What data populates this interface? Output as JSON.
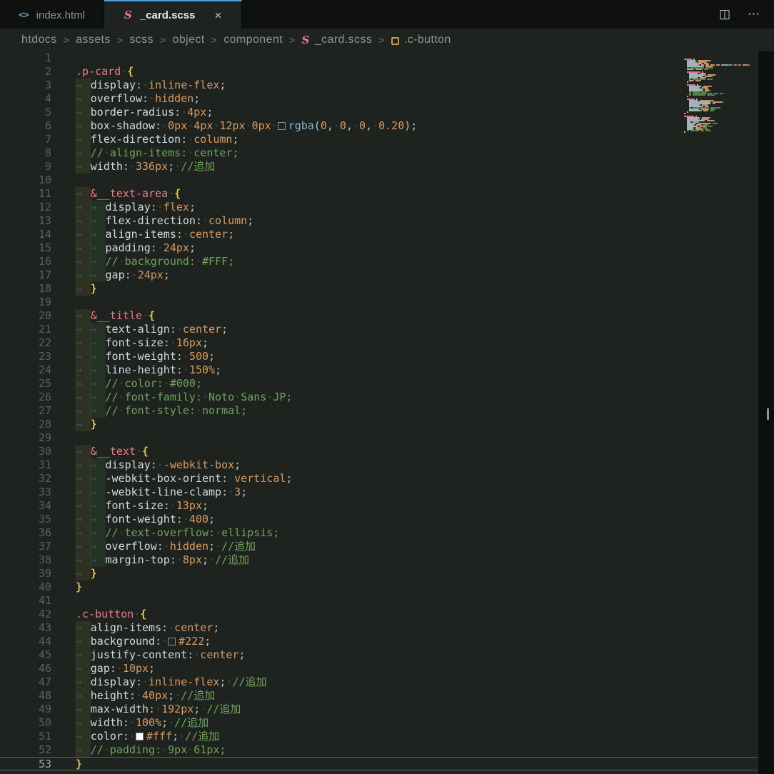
{
  "tabs": [
    {
      "label": "index.html"
    },
    {
      "label": "_card.scss"
    }
  ],
  "icons": {
    "html_file": "<>",
    "sass": "S",
    "close": "×",
    "split_editor": "◫",
    "more_actions": "⋯"
  },
  "breadcrumb": {
    "separator": ">",
    "items": [
      "htdocs",
      "assets",
      "scss",
      "object",
      "component",
      "_card.scss",
      ".c-button"
    ]
  },
  "colors": {
    "background": "#1e231f",
    "tabbar_background": "#0e110e",
    "accent_blue": "#4f9fd8",
    "selector_pink": "#f0788c",
    "brace_yellow": "#e2c05a",
    "property_fg": "#d2dade",
    "value_orange": "#d89a62",
    "comment_green": "#6fa35a",
    "function_blue": "#7ab8d8",
    "sass_icon_pink": "#e977a0",
    "class_symbol_orange": "#d89a40"
  },
  "editor": {
    "current_line": 53,
    "lines": [
      [],
      [
        [
          "sel",
          ".p-card"
        ],
        [
          "ws",
          "·"
        ],
        [
          "brace",
          "{"
        ]
      ],
      [
        [
          "t1",
          "→"
        ],
        [
          "prop",
          "display"
        ],
        [
          "op",
          ":"
        ],
        [
          "ws",
          "·"
        ],
        [
          "val",
          "inline-flex"
        ],
        [
          "op",
          ";"
        ]
      ],
      [
        [
          "t1",
          "→"
        ],
        [
          "prop",
          "overflow"
        ],
        [
          "op",
          ":"
        ],
        [
          "ws",
          "·"
        ],
        [
          "val",
          "hidden"
        ],
        [
          "op",
          ";"
        ]
      ],
      [
        [
          "t1",
          "→"
        ],
        [
          "prop",
          "border-radius"
        ],
        [
          "op",
          ":"
        ],
        [
          "ws",
          "·"
        ],
        [
          "num",
          "4px"
        ],
        [
          "op",
          ";"
        ]
      ],
      [
        [
          "t1",
          "→"
        ],
        [
          "prop",
          "box-shadow"
        ],
        [
          "op",
          ":"
        ],
        [
          "ws",
          "·"
        ],
        [
          "num",
          "0px"
        ],
        [
          "ws",
          "·"
        ],
        [
          "num",
          "4px"
        ],
        [
          "ws",
          "·"
        ],
        [
          "num",
          "12px"
        ],
        [
          "ws",
          "·"
        ],
        [
          "num",
          "0px"
        ],
        [
          "ws",
          "·"
        ],
        [
          "sw",
          "transparent"
        ],
        [
          "fn",
          "rgba"
        ],
        [
          "op",
          "("
        ],
        [
          "num",
          "0"
        ],
        [
          "op",
          ","
        ],
        [
          "ws",
          "·"
        ],
        [
          "num",
          "0"
        ],
        [
          "op",
          ","
        ],
        [
          "ws",
          "·"
        ],
        [
          "num",
          "0"
        ],
        [
          "op",
          ","
        ],
        [
          "ws",
          "·"
        ],
        [
          "num",
          "0.20"
        ],
        [
          "op",
          ")"
        ],
        [
          "op",
          ";"
        ]
      ],
      [
        [
          "t1",
          "→"
        ],
        [
          "prop",
          "flex-direction"
        ],
        [
          "op",
          ":"
        ],
        [
          "ws",
          "·"
        ],
        [
          "val",
          "column"
        ],
        [
          "op",
          ";"
        ]
      ],
      [
        [
          "t1",
          "→"
        ],
        [
          "cm",
          "//"
        ],
        [
          "ws",
          "·"
        ],
        [
          "cm",
          "align-items:"
        ],
        [
          "ws",
          "·"
        ],
        [
          "cm",
          "center;"
        ]
      ],
      [
        [
          "t1",
          "→"
        ],
        [
          "prop",
          "width"
        ],
        [
          "op",
          ":"
        ],
        [
          "ws",
          "·"
        ],
        [
          "num",
          "336px"
        ],
        [
          "op",
          ";"
        ],
        [
          "ws",
          "·"
        ],
        [
          "cm",
          "//追加"
        ]
      ],
      [],
      [
        [
          "t1",
          "→"
        ],
        [
          "sel",
          "&__text-area"
        ],
        [
          "ws",
          "·"
        ],
        [
          "brace",
          "{"
        ]
      ],
      [
        [
          "t1",
          "→"
        ],
        [
          "t2",
          "→"
        ],
        [
          "prop",
          "display"
        ],
        [
          "op",
          ":"
        ],
        [
          "ws",
          "·"
        ],
        [
          "val",
          "flex"
        ],
        [
          "op",
          ";"
        ]
      ],
      [
        [
          "t1",
          "→"
        ],
        [
          "t2",
          "→"
        ],
        [
          "prop",
          "flex-direction"
        ],
        [
          "op",
          ":"
        ],
        [
          "ws",
          "·"
        ],
        [
          "val",
          "column"
        ],
        [
          "op",
          ";"
        ]
      ],
      [
        [
          "t1",
          "→"
        ],
        [
          "t2",
          "→"
        ],
        [
          "prop",
          "align-items"
        ],
        [
          "op",
          ":"
        ],
        [
          "ws",
          "·"
        ],
        [
          "val",
          "center"
        ],
        [
          "op",
          ";"
        ]
      ],
      [
        [
          "t1",
          "→"
        ],
        [
          "t2",
          "→"
        ],
        [
          "prop",
          "padding"
        ],
        [
          "op",
          ":"
        ],
        [
          "ws",
          "·"
        ],
        [
          "num",
          "24px"
        ],
        [
          "op",
          ";"
        ]
      ],
      [
        [
          "t1",
          "→"
        ],
        [
          "t2",
          "→"
        ],
        [
          "cm",
          "//"
        ],
        [
          "ws",
          "·"
        ],
        [
          "cm",
          "background:"
        ],
        [
          "ws",
          "·"
        ],
        [
          "cm",
          "#FFF;"
        ]
      ],
      [
        [
          "t1",
          "→"
        ],
        [
          "t2",
          "→"
        ],
        [
          "prop",
          "gap"
        ],
        [
          "op",
          ":"
        ],
        [
          "ws",
          "·"
        ],
        [
          "num",
          "24px"
        ],
        [
          "op",
          ";"
        ]
      ],
      [
        [
          "t1",
          "→"
        ],
        [
          "brace",
          "}"
        ]
      ],
      [],
      [
        [
          "t1",
          "→"
        ],
        [
          "sel",
          "&__title"
        ],
        [
          "ws",
          "·"
        ],
        [
          "brace",
          "{"
        ]
      ],
      [
        [
          "t1",
          "→"
        ],
        [
          "t2",
          "→"
        ],
        [
          "prop",
          "text-align"
        ],
        [
          "op",
          ":"
        ],
        [
          "ws",
          "·"
        ],
        [
          "val",
          "center"
        ],
        [
          "op",
          ";"
        ]
      ],
      [
        [
          "t1",
          "→"
        ],
        [
          "t2",
          "→"
        ],
        [
          "prop",
          "font-size"
        ],
        [
          "op",
          ":"
        ],
        [
          "ws",
          "·"
        ],
        [
          "num",
          "16px"
        ],
        [
          "op",
          ";"
        ]
      ],
      [
        [
          "t1",
          "→"
        ],
        [
          "t2",
          "→"
        ],
        [
          "prop",
          "font-weight"
        ],
        [
          "op",
          ":"
        ],
        [
          "ws",
          "·"
        ],
        [
          "num",
          "500"
        ],
        [
          "op",
          ";"
        ]
      ],
      [
        [
          "t1",
          "→"
        ],
        [
          "t2",
          "→"
        ],
        [
          "prop",
          "line-height"
        ],
        [
          "op",
          ":"
        ],
        [
          "ws",
          "·"
        ],
        [
          "num",
          "150%"
        ],
        [
          "op",
          ";"
        ]
      ],
      [
        [
          "t1",
          "→"
        ],
        [
          "t2",
          "→"
        ],
        [
          "cm",
          "//"
        ],
        [
          "ws",
          "·"
        ],
        [
          "cm",
          "color:"
        ],
        [
          "ws",
          "·"
        ],
        [
          "cm",
          "#000;"
        ]
      ],
      [
        [
          "t1",
          "→"
        ],
        [
          "t2",
          "→"
        ],
        [
          "cm",
          "//"
        ],
        [
          "ws",
          "·"
        ],
        [
          "cm",
          "font-family:"
        ],
        [
          "ws",
          "·"
        ],
        [
          "cm",
          "Noto"
        ],
        [
          "ws",
          "·"
        ],
        [
          "cm",
          "Sans"
        ],
        [
          "ws",
          "·"
        ],
        [
          "cm",
          "JP;"
        ]
      ],
      [
        [
          "t1",
          "→"
        ],
        [
          "t2",
          "→"
        ],
        [
          "cm",
          "//"
        ],
        [
          "ws",
          "·"
        ],
        [
          "cm",
          "font-style:"
        ],
        [
          "ws",
          "·"
        ],
        [
          "cm",
          "normal;"
        ]
      ],
      [
        [
          "t1",
          "→"
        ],
        [
          "brace",
          "}"
        ]
      ],
      [],
      [
        [
          "t1",
          "→"
        ],
        [
          "sel",
          "&__text"
        ],
        [
          "ws",
          "·"
        ],
        [
          "brace",
          "{"
        ]
      ],
      [
        [
          "t1",
          "→"
        ],
        [
          "t2",
          "→"
        ],
        [
          "prop",
          "display"
        ],
        [
          "op",
          ":"
        ],
        [
          "ws",
          "·"
        ],
        [
          "val",
          "-webkit-box"
        ],
        [
          "op",
          ";"
        ]
      ],
      [
        [
          "t1",
          "→"
        ],
        [
          "t2",
          "→"
        ],
        [
          "prop",
          "-webkit-box-orient"
        ],
        [
          "op",
          ":"
        ],
        [
          "ws",
          "·"
        ],
        [
          "val",
          "vertical"
        ],
        [
          "op",
          ";"
        ]
      ],
      [
        [
          "t1",
          "→"
        ],
        [
          "t2",
          "→"
        ],
        [
          "prop",
          "-webkit-line-clamp"
        ],
        [
          "op",
          ":"
        ],
        [
          "ws",
          "·"
        ],
        [
          "num",
          "3"
        ],
        [
          "op",
          ";"
        ]
      ],
      [
        [
          "t1",
          "→"
        ],
        [
          "t2",
          "→"
        ],
        [
          "prop",
          "font-size"
        ],
        [
          "op",
          ":"
        ],
        [
          "ws",
          "·"
        ],
        [
          "num",
          "13px"
        ],
        [
          "op",
          ";"
        ]
      ],
      [
        [
          "t1",
          "→"
        ],
        [
          "t2",
          "→"
        ],
        [
          "prop",
          "font-weight"
        ],
        [
          "op",
          ":"
        ],
        [
          "ws",
          "·"
        ],
        [
          "num",
          "400"
        ],
        [
          "op",
          ";"
        ]
      ],
      [
        [
          "t1",
          "→"
        ],
        [
          "t2",
          "→"
        ],
        [
          "cm",
          "//"
        ],
        [
          "ws",
          "·"
        ],
        [
          "cm",
          "text-overflow:"
        ],
        [
          "ws",
          "·"
        ],
        [
          "cm",
          "ellipsis;"
        ]
      ],
      [
        [
          "t1",
          "→"
        ],
        [
          "t2",
          "→"
        ],
        [
          "prop",
          "overflow"
        ],
        [
          "op",
          ":"
        ],
        [
          "ws",
          "·"
        ],
        [
          "val",
          "hidden"
        ],
        [
          "op",
          ";"
        ],
        [
          "ws",
          "·"
        ],
        [
          "cm",
          "//追加"
        ]
      ],
      [
        [
          "t1",
          "→"
        ],
        [
          "t2",
          "→"
        ],
        [
          "prop",
          "margin-top"
        ],
        [
          "op",
          ":"
        ],
        [
          "ws",
          "·"
        ],
        [
          "num",
          "8px"
        ],
        [
          "op",
          ";"
        ],
        [
          "ws",
          "·"
        ],
        [
          "cm",
          "//追加"
        ]
      ],
      [
        [
          "t1",
          "→"
        ],
        [
          "brace",
          "}"
        ]
      ],
      [
        [
          "brace",
          "}"
        ]
      ],
      [],
      [
        [
          "sel",
          ".c-button"
        ],
        [
          "ws",
          "·"
        ],
        [
          "brace",
          "{"
        ]
      ],
      [
        [
          "t1",
          "→"
        ],
        [
          "prop",
          "align-items"
        ],
        [
          "op",
          ":"
        ],
        [
          "ws",
          "·"
        ],
        [
          "val",
          "center"
        ],
        [
          "op",
          ";"
        ]
      ],
      [
        [
          "t1",
          "→"
        ],
        [
          "prop",
          "background"
        ],
        [
          "op",
          ":"
        ],
        [
          "ws",
          "·"
        ],
        [
          "sw",
          "#222222"
        ],
        [
          "num",
          "#222"
        ],
        [
          "op",
          ";"
        ]
      ],
      [
        [
          "t1",
          "→"
        ],
        [
          "prop",
          "justify-content"
        ],
        [
          "op",
          ":"
        ],
        [
          "ws",
          "·"
        ],
        [
          "val",
          "center"
        ],
        [
          "op",
          ";"
        ]
      ],
      [
        [
          "t1",
          "→"
        ],
        [
          "prop",
          "gap"
        ],
        [
          "op",
          ":"
        ],
        [
          "ws",
          "·"
        ],
        [
          "num",
          "10px"
        ],
        [
          "op",
          ";"
        ]
      ],
      [
        [
          "t1",
          "→"
        ],
        [
          "prop",
          "display"
        ],
        [
          "op",
          ":"
        ],
        [
          "ws",
          "·"
        ],
        [
          "val",
          "inline-flex"
        ],
        [
          "op",
          ";"
        ],
        [
          "ws",
          "·"
        ],
        [
          "cm",
          "//追加"
        ]
      ],
      [
        [
          "t1",
          "→"
        ],
        [
          "prop",
          "height"
        ],
        [
          "op",
          ":"
        ],
        [
          "ws",
          "·"
        ],
        [
          "num",
          "40px"
        ],
        [
          "op",
          ";"
        ],
        [
          "ws",
          "·"
        ],
        [
          "cm",
          "//追加"
        ]
      ],
      [
        [
          "t1",
          "→"
        ],
        [
          "prop",
          "max-width"
        ],
        [
          "op",
          ":"
        ],
        [
          "ws",
          "·"
        ],
        [
          "num",
          "192px"
        ],
        [
          "op",
          ";"
        ],
        [
          "ws",
          "·"
        ],
        [
          "cm",
          "//追加"
        ]
      ],
      [
        [
          "t1",
          "→"
        ],
        [
          "prop",
          "width"
        ],
        [
          "op",
          ":"
        ],
        [
          "ws",
          "·"
        ],
        [
          "num",
          "100%"
        ],
        [
          "op",
          ";"
        ],
        [
          "ws",
          "·"
        ],
        [
          "cm",
          "//追加"
        ]
      ],
      [
        [
          "t1",
          "→"
        ],
        [
          "prop",
          "color"
        ],
        [
          "op",
          ":"
        ],
        [
          "ws",
          "·"
        ],
        [
          "sw",
          "#ffffff"
        ],
        [
          "num",
          "#fff"
        ],
        [
          "op",
          ";"
        ],
        [
          "ws",
          "·"
        ],
        [
          "cm",
          "//追加"
        ]
      ],
      [
        [
          "t1",
          "→"
        ],
        [
          "cm",
          "//"
        ],
        [
          "ws",
          "·"
        ],
        [
          "cm",
          "padding:"
        ],
        [
          "ws",
          "·"
        ],
        [
          "cm",
          "9px"
        ],
        [
          "ws",
          "·"
        ],
        [
          "cm",
          "61px;"
        ]
      ],
      [
        [
          "brace",
          "}"
        ]
      ]
    ]
  }
}
